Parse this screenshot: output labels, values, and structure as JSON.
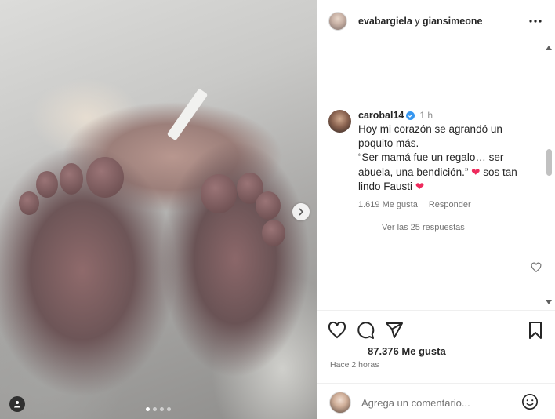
{
  "header": {
    "user1": "evabargiela",
    "connector": "y",
    "user2": "giansimeone"
  },
  "comment": {
    "username": "carobal14",
    "time": "1 h",
    "text_line1": "Hoy mi corazón se agrandó un poquito más.",
    "text_line2": "“Ser mamá fue un regalo… ser abuela, una bendición.”",
    "emoji1": "❤",
    "text_line3": "sos tan lindo Fausti",
    "emoji2": "❤",
    "likes": "1.619 Me gusta",
    "reply": "Responder",
    "view_replies": "Ver las 25 respuestas"
  },
  "post": {
    "likes": "87.376 Me gusta",
    "time_ago": "Hace 2 horas"
  },
  "add_comment": {
    "placeholder": "Agrega un comentario..."
  },
  "carousel": {
    "count": 4,
    "active_index": 0
  },
  "colors": {
    "verified": "#3797f0",
    "heart": "#ee2a5c"
  },
  "icons": [
    "more-icon",
    "heart-icon",
    "comment-icon",
    "share-icon",
    "bookmark-icon",
    "emoji-icon",
    "chevron-right-icon",
    "user-tag-icon",
    "verified-icon"
  ]
}
